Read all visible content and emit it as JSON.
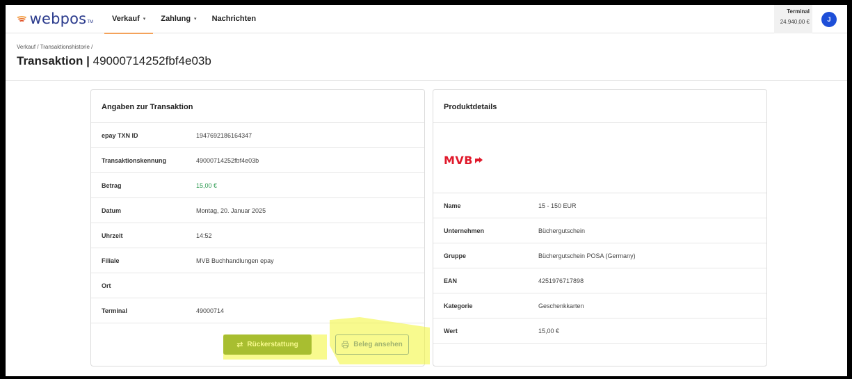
{
  "app": {
    "logo_text": "webpos",
    "logo_tm": "TM",
    "brand_colors": {
      "primary": "#2a3a8c",
      "accent": "#f4a25a"
    }
  },
  "nav": {
    "items": [
      {
        "label": "Verkauf",
        "caret": "▾"
      },
      {
        "label": "Zahlung",
        "caret": "▾"
      },
      {
        "label": "Nachrichten",
        "caret": ""
      }
    ]
  },
  "terminal": {
    "label": "Terminal",
    "value": "24.940,00 €"
  },
  "user": {
    "initial": "J"
  },
  "breadcrumb": "Verkauf / Transaktionshistorie /",
  "title": {
    "bold": "Transaktion |",
    "id": " 49000714252fbf4e03b"
  },
  "transaction": {
    "heading": "Angaben zur Transaktion",
    "rows": [
      {
        "label": "epay TXN ID",
        "value": "1947692186164347"
      },
      {
        "label": "Transaktionskennung",
        "value": "49000714252fbf4e03b"
      },
      {
        "label": "Betrag",
        "value": "15,00 €"
      },
      {
        "label": "Datum",
        "value": "Montag, 20. Januar 2025"
      },
      {
        "label": "Uhrzeit",
        "value": "14:52"
      },
      {
        "label": "Filiale",
        "value": "MVB Buchhandlungen epay"
      },
      {
        "label": "Ort",
        "value": ""
      },
      {
        "label": "Terminal",
        "value": "49000714"
      }
    ],
    "refund_label": "Rückerstattung",
    "receipt_label": "Beleg ansehen"
  },
  "product": {
    "heading": "Produktdetails",
    "logo_text": "MVB",
    "rows": [
      {
        "label": "Name",
        "value": "15 - 150 EUR"
      },
      {
        "label": "Unternehmen",
        "value": "Büchergutschein"
      },
      {
        "label": "Gruppe",
        "value": "Büchergutschein POSA (Germany)"
      },
      {
        "label": "EAN",
        "value": "4251976717898"
      },
      {
        "label": "Kategorie",
        "value": "Geschenkkarten"
      },
      {
        "label": "Wert",
        "value": "15,00 €"
      }
    ]
  }
}
